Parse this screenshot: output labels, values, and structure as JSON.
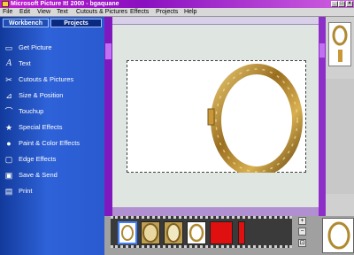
{
  "window": {
    "title": "Microsoft Picture It! 2000 - bgaquane",
    "controls": [
      "_",
      "□",
      "×"
    ]
  },
  "menu": [
    "File",
    "Edit",
    "View",
    "Text",
    "Cutouts & Pictures",
    "Effects",
    "Projects",
    "Help"
  ],
  "sidebar": {
    "tabs": [
      "Workbench",
      "Projects"
    ],
    "items": [
      {
        "label": "Get Picture",
        "icon": "folder-icon"
      },
      {
        "label": "Text",
        "icon": "text-a-icon"
      },
      {
        "label": "Cutouts & Pictures",
        "icon": "scissors-icon"
      },
      {
        "label": "Size & Position",
        "icon": "size-icon"
      },
      {
        "label": "Touchup",
        "icon": "touchup-icon"
      },
      {
        "label": "Special Effects",
        "icon": "star-icon"
      },
      {
        "label": "Paint & Color Effects",
        "icon": "paint-icon"
      },
      {
        "label": "Edge Effects",
        "icon": "edge-icon"
      },
      {
        "label": "Save & Send",
        "icon": "save-icon"
      },
      {
        "label": "Print",
        "icon": "printer-icon"
      }
    ]
  },
  "zoom_controls": [
    "+",
    "−",
    "⊡"
  ],
  "colors": {
    "sidebar": "#2a5ad0",
    "frame_gold": "#b08a30",
    "titlebar": "#c020d0",
    "red_thumb": "#e01010"
  }
}
